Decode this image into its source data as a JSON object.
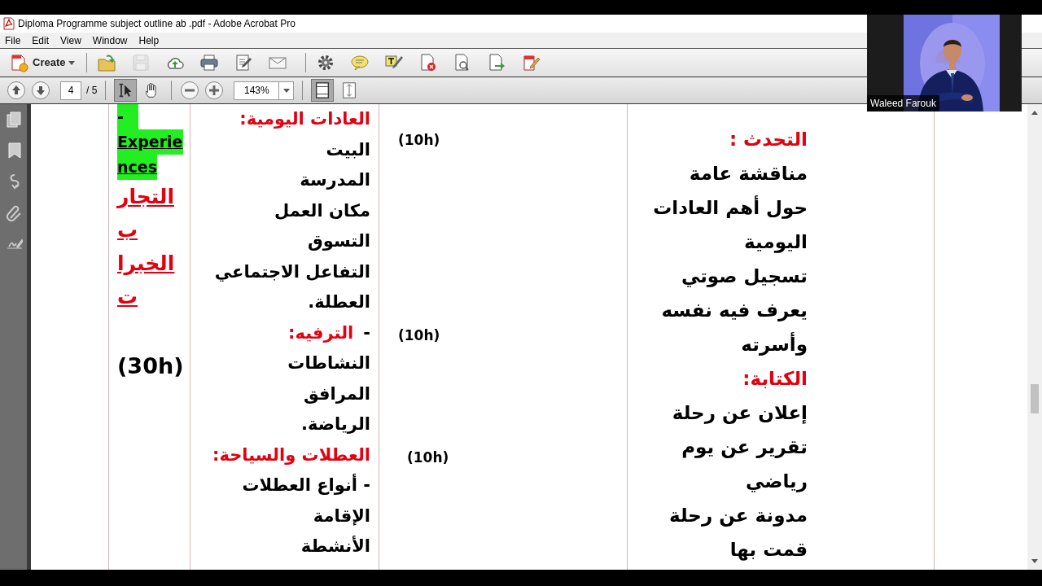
{
  "window": {
    "title": "Diploma Programme subject outline ab .pdf - Adobe Acrobat Pro"
  },
  "menu": {
    "file": "File",
    "edit": "Edit",
    "view": "View",
    "window": "Window",
    "help": "Help"
  },
  "toolbar": {
    "create_label": "Create",
    "groups": [
      [
        {
          "kind": "open",
          "disabled": false
        },
        {
          "kind": "save",
          "disabled": true
        },
        {
          "kind": "upload",
          "disabled": false
        },
        {
          "kind": "print",
          "disabled": false
        },
        {
          "kind": "edit",
          "disabled": false
        },
        {
          "kind": "email",
          "disabled": false
        }
      ],
      [
        {
          "kind": "settings",
          "disabled": false
        },
        {
          "kind": "comment",
          "disabled": false
        },
        {
          "kind": "highlight",
          "disabled": false
        },
        {
          "kind": "delete-page",
          "disabled": false
        },
        {
          "kind": "search-doc",
          "disabled": false
        },
        {
          "kind": "export",
          "disabled": false
        },
        {
          "kind": "sign",
          "disabled": false
        }
      ]
    ]
  },
  "navigation": {
    "page": "4",
    "page_count": "/ 5",
    "zoom": "143%",
    "tools": [
      {
        "kind": "select",
        "selected": true
      },
      {
        "kind": "hand",
        "selected": false
      }
    ],
    "views": [
      {
        "kind": "fit-page",
        "selected": true
      },
      {
        "kind": "fit-width",
        "selected": false
      }
    ]
  },
  "document": {
    "column_1": {
      "english": [
        "-",
        "Experie",
        "nces"
      ],
      "arabic": [
        "التجار",
        "ب",
        "الخبرا",
        "ت"
      ],
      "hours": "(30h)"
    },
    "column_2": [
      {
        "kind": "heading",
        "text": "العادات اليومية:"
      },
      {
        "kind": "line",
        "text": "البيت"
      },
      {
        "kind": "line",
        "text": "المدرسة"
      },
      {
        "kind": "line",
        "text": "مكان العمل"
      },
      {
        "kind": "line",
        "text": "التسوق"
      },
      {
        "kind": "line",
        "text": "التفاعل الاجتماعي"
      },
      {
        "kind": "line",
        "text": "العطلة."
      },
      {
        "kind": "heading",
        "dash": "-",
        "text": "الترفيه:"
      },
      {
        "kind": "line",
        "text": "النشاطات"
      },
      {
        "kind": "line",
        "text": "المرافق"
      },
      {
        "kind": "line",
        "text": "الرياضة."
      },
      {
        "kind": "heading",
        "text": "العطلات والسياحة:"
      },
      {
        "kind": "line",
        "text": "- أنواع العطلات"
      },
      {
        "kind": "line",
        "text": "الإقامة"
      },
      {
        "kind": "line",
        "text": "الأنشطة"
      }
    ],
    "column_3": [
      "(10h)",
      "(10h)",
      "(10h)"
    ],
    "column_4": [
      {
        "kind": "heading",
        "text": "التحدث :"
      },
      {
        "kind": "line",
        "text": "مناقشة عامة"
      },
      {
        "kind": "line",
        "text": "حول أهم العادات"
      },
      {
        "kind": "line",
        "text": "اليومية"
      },
      {
        "kind": "line",
        "text": "تسجيل صوتي"
      },
      {
        "kind": "line",
        "text": "يعرف فيه نفسه"
      },
      {
        "kind": "line",
        "text": "وأسرته"
      },
      {
        "kind": "heading",
        "text": "الكتابة:"
      },
      {
        "kind": "line",
        "text": "إعلان عن رحلة"
      },
      {
        "kind": "line",
        "text": "تقرير عن يوم"
      },
      {
        "kind": "line",
        "text": "رياضي"
      },
      {
        "kind": "line",
        "text": "مدونة عن رحلة"
      },
      {
        "kind": "line",
        "text": "قمت بها"
      }
    ]
  },
  "video": {
    "name": "Waleed Farouk"
  }
}
